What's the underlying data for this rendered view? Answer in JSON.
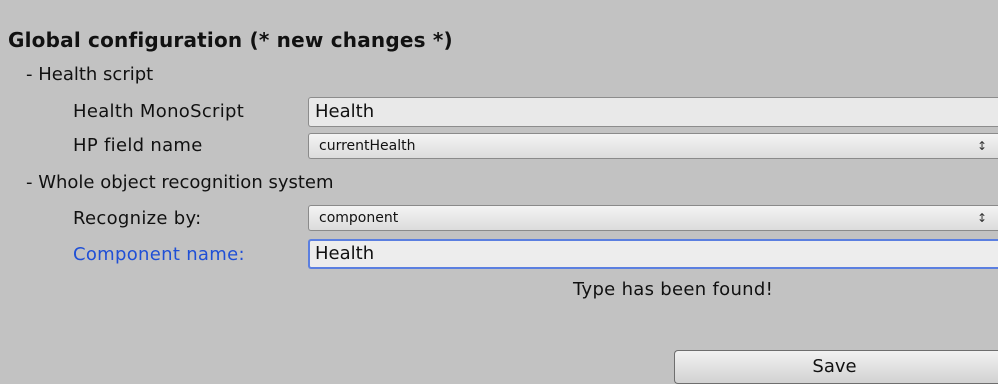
{
  "header": {
    "title": "Global configuration (* new changes *)"
  },
  "health_script": {
    "section_label": "- Health script",
    "monoscript_label": "Health MonoScript",
    "monoscript_value": "Health",
    "hp_field_label": "HP field name",
    "hp_field_value": "currentHealth",
    "dropdown_icon": "up-down-arrows-icon"
  },
  "recognition": {
    "section_label": "- Whole object recognition system",
    "recognize_by_label": "Recognize by:",
    "recognize_by_value": "component",
    "component_name_label": "Component name:",
    "component_name_value": "Health",
    "status_text": "Type has been found!"
  },
  "actions": {
    "save_label": "Save"
  },
  "colors": {
    "background": "#c2c2c2",
    "active_label": "#1f4fd6",
    "focus_border": "#5b7fe0"
  }
}
